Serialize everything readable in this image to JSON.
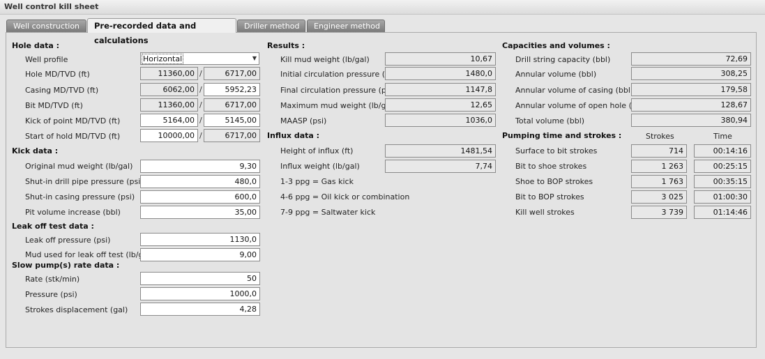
{
  "window": {
    "title": "Well control kill sheet"
  },
  "tabs": [
    {
      "label": "Well construction"
    },
    {
      "label": "Pre-recorded data and calculations"
    },
    {
      "label": "Driller method"
    },
    {
      "label": "Engineer method"
    }
  ],
  "hole": {
    "header": "Hole data :",
    "well_profile": {
      "label": "Well profile",
      "value": "Horizontal"
    },
    "rows": [
      {
        "label": "Hole MD/TVD (ft)",
        "md": "11360,00",
        "tvd": "6717,00"
      },
      {
        "label": "Casing MD/TVD (ft)",
        "md": "6062,00",
        "tvd": "5952,23"
      },
      {
        "label": "Bit MD/TVD (ft)",
        "md": "11360,00",
        "tvd": "6717,00"
      },
      {
        "label": "Kick of point MD/TVD (ft)",
        "md": "5164,00",
        "tvd": "5145,00"
      },
      {
        "label": "Start of hold MD/TVD (ft)",
        "md": "10000,00",
        "tvd": "6717,00"
      }
    ],
    "separator": "/"
  },
  "kick": {
    "header": "Kick data :",
    "rows": [
      {
        "label": "Original mud weight (lb/gal)",
        "value": "9,30"
      },
      {
        "label": "Shut-in drill pipe pressure (psi)",
        "value": "480,0"
      },
      {
        "label": "Shut-in casing pressure (psi)",
        "value": "600,0"
      },
      {
        "label": "Pit volume increase (bbl)",
        "value": "35,00"
      }
    ]
  },
  "leak": {
    "header": "Leak off test data :",
    "rows": [
      {
        "label": "Leak off pressure (psi)",
        "value": "1130,0"
      },
      {
        "label": "Mud used for leak off test (lb/gal)",
        "value": "9,00"
      }
    ]
  },
  "slow_pump": {
    "header": "Slow pump(s) rate data :",
    "rows": [
      {
        "label": "Rate (stk/min)",
        "value": "50"
      },
      {
        "label": "Pressure (psi)",
        "value": "1000,0"
      },
      {
        "label": "Strokes displacement (gal)",
        "value": "4,28"
      }
    ]
  },
  "results": {
    "header": "Results :",
    "rows": [
      {
        "label": "Kill mud weight (lb/gal)",
        "value": "10,67"
      },
      {
        "label": "Initial circulation pressure (psi)",
        "value": "1480,0"
      },
      {
        "label": "Final circulation pressure (psi)",
        "value": "1147,8"
      },
      {
        "label": "Maximum mud weight (lb/gal)",
        "value": "12,65"
      },
      {
        "label": "MAASP (psi)",
        "value": "1036,0"
      }
    ]
  },
  "influx": {
    "header": "Influx data :",
    "rows": [
      {
        "label": "Height of influx (ft)",
        "value": "1481,54"
      },
      {
        "label": "Influx weight (lb/gal)",
        "value": "7,74"
      }
    ],
    "notes": [
      "1-3 ppg = Gas kick",
      "4-6 ppg = Oil kick or combination",
      "7-9 ppg = Saltwater kick"
    ]
  },
  "capacities": {
    "header": "Capacities and volumes :",
    "rows": [
      {
        "label": "Drill string capacity (bbl)",
        "value": "72,69"
      },
      {
        "label": "Annular volume (bbl)",
        "value": "308,25"
      },
      {
        "label": "Annular volume of casing (bbl)",
        "value": "179,58"
      },
      {
        "label": "Annular volume of open hole (bbl)",
        "value": "128,67"
      },
      {
        "label": "Total volume (bbl)",
        "value": "380,94"
      }
    ]
  },
  "pumping": {
    "header": "Pumping time and strokes :",
    "col_strokes": "Strokes",
    "col_time": "Time",
    "rows": [
      {
        "label": "Surface to bit strokes",
        "strokes": "714",
        "time": "00:14:16"
      },
      {
        "label": "Bit to shoe strokes",
        "strokes": "1 263",
        "time": "00:25:15"
      },
      {
        "label": "Shoe to BOP strokes",
        "strokes": "1 763",
        "time": "00:35:15"
      },
      {
        "label": "Bit to BOP strokes",
        "strokes": "3 025",
        "time": "01:00:30"
      },
      {
        "label": "Kill well strokes",
        "strokes": "3 739",
        "time": "01:14:46"
      }
    ]
  }
}
